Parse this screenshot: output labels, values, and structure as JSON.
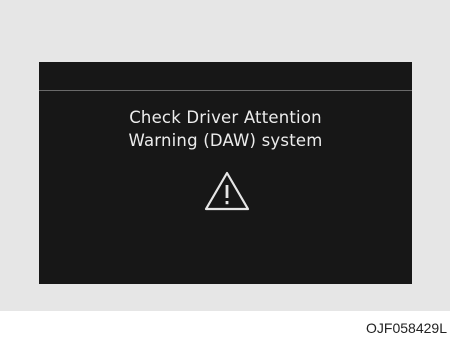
{
  "screen": {
    "message_line1": "Check Driver Attention",
    "message_line2": "Warning (DAW) system",
    "icon": "warning-triangle-icon"
  },
  "caption": "OJF058429L",
  "colors": {
    "display_background": "#171717",
    "text": "#ececec",
    "frame": "#e6e6e6"
  }
}
